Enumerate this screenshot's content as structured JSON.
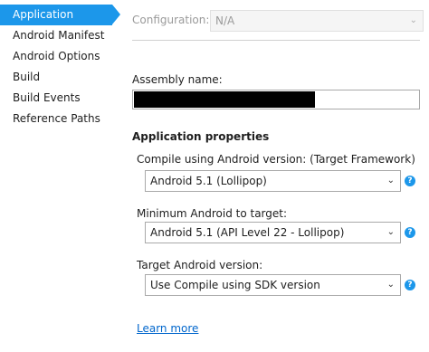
{
  "sidebar": {
    "items": [
      {
        "label": "Application",
        "active": true
      },
      {
        "label": "Android Manifest",
        "active": false
      },
      {
        "label": "Android Options",
        "active": false
      },
      {
        "label": "Build",
        "active": false
      },
      {
        "label": "Build Events",
        "active": false
      },
      {
        "label": "Reference Paths",
        "active": false
      }
    ]
  },
  "config": {
    "label": "Configuration:",
    "value": "N/A"
  },
  "assembly": {
    "label": "Assembly name:",
    "value": ""
  },
  "app_properties": {
    "heading": "Application properties",
    "compile": {
      "label": "Compile using Android version:  (Target Framework)",
      "value": "Android 5.1 (Lollipop)"
    },
    "minimum": {
      "label": "Minimum Android to target:",
      "value": "Android 5.1 (API Level 22 - Lollipop)"
    },
    "target": {
      "label": "Target Android version:",
      "value": "Use Compile using SDK version"
    }
  },
  "learn_more": "Learn more",
  "colors": {
    "accent": "#1c97ea",
    "link": "#0066cc",
    "disabled_text": "#9a9a9a"
  },
  "icons": {
    "dropdown": "chevron-down-icon",
    "help": "help-icon"
  }
}
